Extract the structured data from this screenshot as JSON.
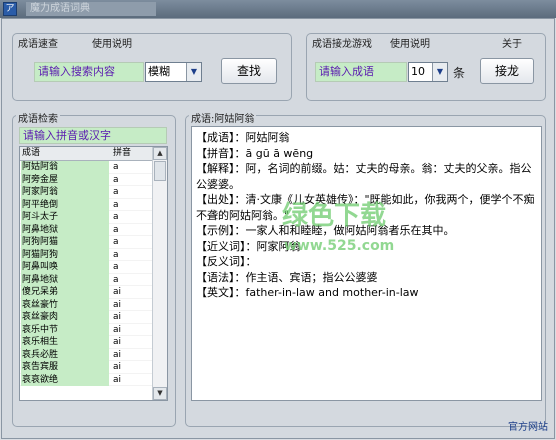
{
  "app": {
    "title": "魔力成语词典",
    "icon_glyph": "ア"
  },
  "search": {
    "group_label": "成语速查",
    "help_label": "使用说明",
    "input_value": "请输入搜索内容",
    "mode_value": "模糊",
    "button_label": "查找"
  },
  "game": {
    "group_label": "成语接龙游戏",
    "help_label": "使用说明",
    "about_label": "关于",
    "input_value": "请输入成语",
    "count_value": "10",
    "count_unit": "条",
    "button_label": "接龙"
  },
  "index": {
    "group_label": "成语检索",
    "input_value": "请输入拼音或汉字",
    "col_idiom": "成语",
    "col_pinyin": "拼音",
    "rows": [
      {
        "idiom": "阿姑阿翁",
        "pinyin": "a"
      },
      {
        "idiom": "阿旁金屋",
        "pinyin": "a"
      },
      {
        "idiom": "阿家阿翁",
        "pinyin": "a"
      },
      {
        "idiom": "阿平绝倒",
        "pinyin": "a"
      },
      {
        "idiom": "阿斗太子",
        "pinyin": "a"
      },
      {
        "idiom": "阿鼻地狱",
        "pinyin": "a"
      },
      {
        "idiom": "阿狗阿猫",
        "pinyin": "a"
      },
      {
        "idiom": "阿猫阿狗",
        "pinyin": "a"
      },
      {
        "idiom": "阿鼻叫唤",
        "pinyin": "a"
      },
      {
        "idiom": "阿鼻地狱",
        "pinyin": "a"
      },
      {
        "idiom": "傻兄呆弟",
        "pinyin": "ai"
      },
      {
        "idiom": "哀丝豪竹",
        "pinyin": "ai"
      },
      {
        "idiom": "哀丝豪肉",
        "pinyin": "ai"
      },
      {
        "idiom": "哀乐中节",
        "pinyin": "ai"
      },
      {
        "idiom": "哀乐相生",
        "pinyin": "ai"
      },
      {
        "idiom": "哀兵必胜",
        "pinyin": "ai"
      },
      {
        "idiom": "哀告宾服",
        "pinyin": "ai"
      },
      {
        "idiom": "哀哀欲绝",
        "pinyin": "ai"
      }
    ]
  },
  "detail": {
    "group_label": "成语:阿姑阿翁",
    "lines": [
      "【成语】：阿姑阿翁",
      "【拼音】：ā gū ā wēng",
      "【解释】：阿，名词的前缀。姑：丈夫的母亲。翁：丈夫的父亲。指公公婆婆。",
      "【出处】：清·文康《儿女英雄传》：\"既能如此，你我两个，便学个不痴不聋的阿姑阿翁。\"",
      "【示例】：一家人和和睦睦，做阿姑阿翁者乐在其中。",
      "【近义词】：阿家阿翁",
      "【反义词】：",
      "【语法】：作主语、宾语；指公公婆婆",
      "【英文】：father-in-law and mother-in-law"
    ]
  },
  "watermark": {
    "line1": "绿色下载",
    "line2": "www.525.com"
  },
  "footer": {
    "link_label": "官方网站"
  },
  "colors": {
    "input_bg": "#c6ecc6",
    "input_text": "#5a1ab0",
    "link": "#1d3f8a"
  }
}
